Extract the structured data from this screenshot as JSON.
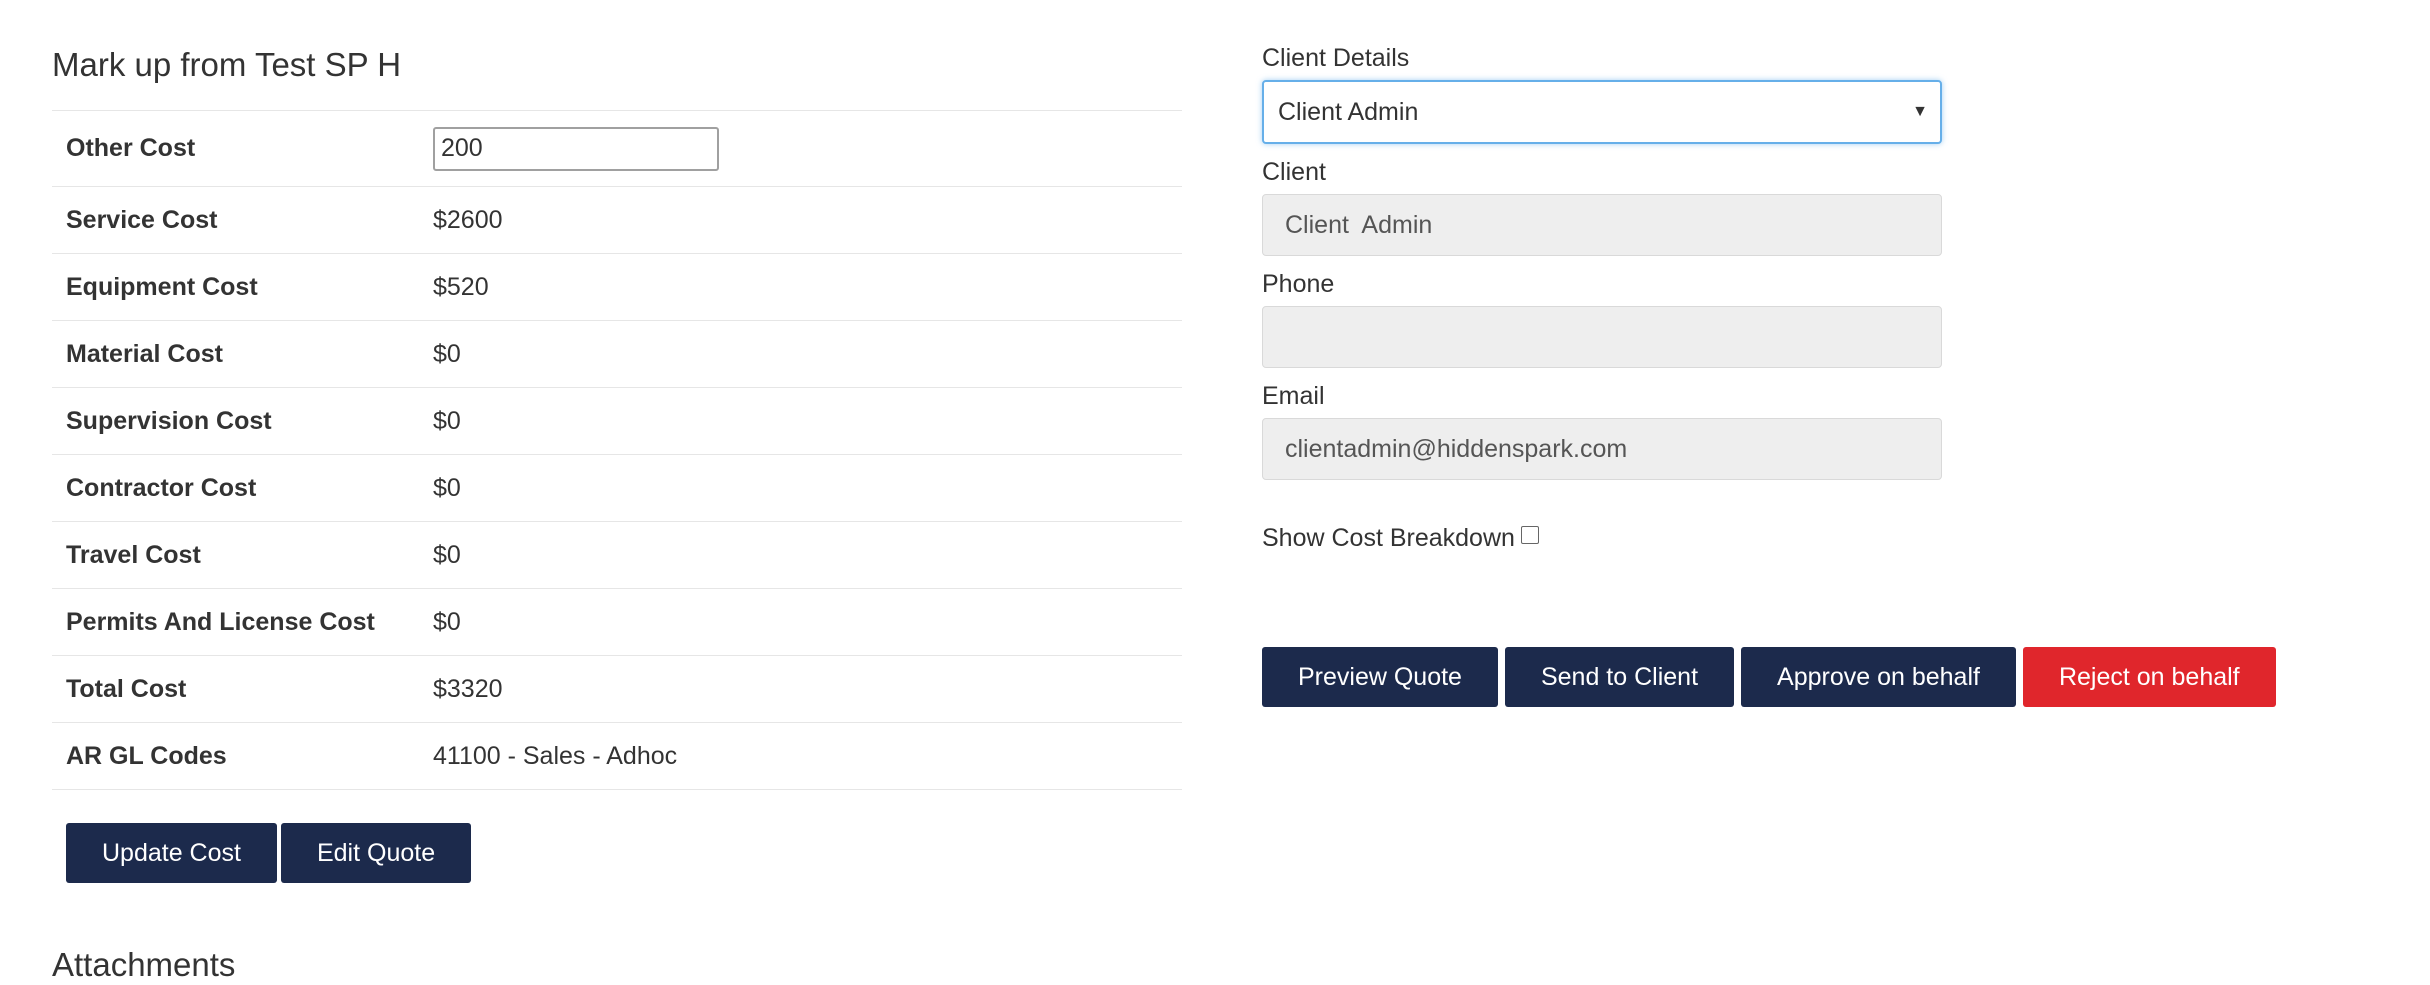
{
  "markup": {
    "title": "Mark up from Test SP H",
    "rows": [
      {
        "label": "Other Cost",
        "value": "200"
      },
      {
        "label": "Service Cost",
        "value": "$2600"
      },
      {
        "label": "Equipment Cost",
        "value": "$520"
      },
      {
        "label": "Material Cost",
        "value": "$0"
      },
      {
        "label": "Supervision Cost",
        "value": "$0"
      },
      {
        "label": "Contractor Cost",
        "value": "$0"
      },
      {
        "label": "Travel Cost",
        "value": "$0"
      },
      {
        "label": "Permits And License Cost",
        "value": "$0"
      },
      {
        "label": "Total Cost",
        "value": "$3320"
      },
      {
        "label": "AR GL Codes",
        "value": "41100 - Sales - Adhoc"
      }
    ],
    "buttons": {
      "update_cost": "Update Cost",
      "edit_quote": "Edit Quote"
    },
    "attachments_heading": "Attachments"
  },
  "client": {
    "details_label": "Client Details",
    "details_selected": "Client Admin",
    "client_label": "Client",
    "client_value": "Client  Admin",
    "phone_label": "Phone",
    "phone_value": "",
    "email_label": "Email",
    "email_value": "clientadmin@hiddenspark.com",
    "show_cost_breakdown_label": "Show Cost Breakdown",
    "show_cost_breakdown_checked": false
  },
  "actions": {
    "preview_quote": "Preview Quote",
    "send_to_client": "Send to Client",
    "approve_on_behalf": "Approve on behalf",
    "reject_on_behalf": "Reject on behalf"
  },
  "colors": {
    "primary_button": "#1c2a4c",
    "danger_button": "#e0262c",
    "focus_border": "#66afe9",
    "readonly_bg": "#eeeeee"
  }
}
